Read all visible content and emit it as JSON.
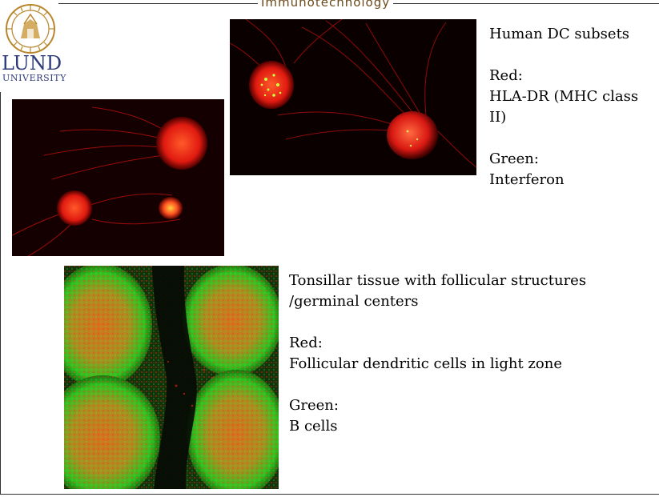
{
  "header": {
    "title": "Immunotechnology"
  },
  "logo": {
    "name": "LUND",
    "subtitle": "UNIVERSITY"
  },
  "captions": {
    "dc": {
      "title": "Human DC subsets",
      "red_label": "Red:",
      "red_text": "HLA-DR (MHC class II)",
      "green_label": "Green:",
      "green_text": "Interferon"
    },
    "tonsil": {
      "title_line1": "Tonsillar tissue with follicular structures",
      "title_line2": "/germinal centers",
      "red_label": "Red:",
      "red_text": "Follicular dendritic cells in light zone",
      "green_label": "Green:",
      "green_text": "B cells"
    }
  },
  "colors": {
    "brand_blue": "#2b3a78",
    "header_brown": "#6b4a1a",
    "stain_red": "#ff2a1a",
    "stain_green": "#33dd22"
  }
}
